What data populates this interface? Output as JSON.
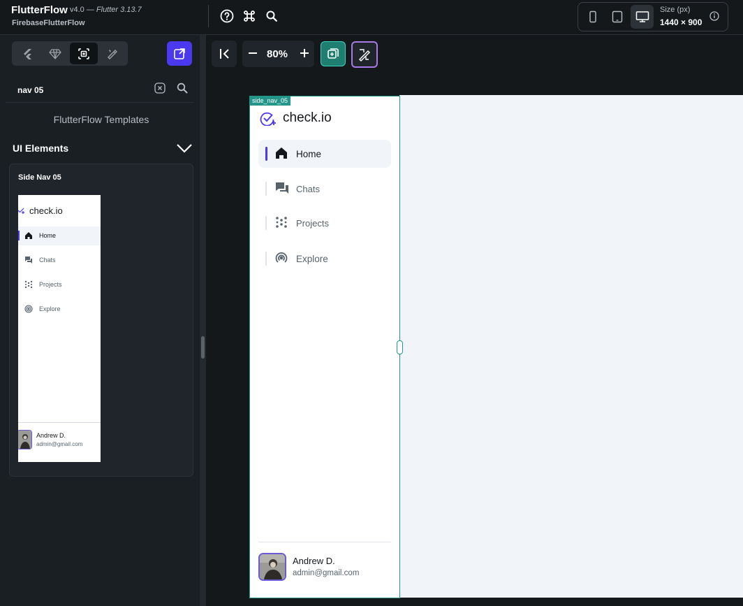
{
  "app": {
    "name": "FlutterFlow",
    "version": "v4.0 — ",
    "flutter_version": "Flutter 3.13.7",
    "project": "FirebaseFlutterFlow"
  },
  "toolbar": {
    "icons": [
      "help-icon",
      "command-icon",
      "search-icon"
    ]
  },
  "device": {
    "size_label": "Size (px)",
    "size_value": "1440 × 900",
    "options": [
      "phone",
      "tablet",
      "desktop"
    ],
    "selected": "desktop"
  },
  "left_panel": {
    "tabs": [
      "flutter-widgets",
      "components",
      "templates",
      "themes"
    ],
    "active_tab": "templates",
    "search_value": "nav 05",
    "templates_label": "FlutterFlow Templates",
    "section_title": "UI Elements",
    "card": {
      "title": "Side Nav 05"
    }
  },
  "canvas": {
    "zoom": "80%",
    "frame_tag": "side_nav_05"
  },
  "side_nav": {
    "logo": "check.io",
    "items": [
      {
        "label": "Home",
        "icon": "home-icon",
        "active": true
      },
      {
        "label": "Chats",
        "icon": "chat-icon",
        "active": false
      },
      {
        "label": "Projects",
        "icon": "dots-grid-icon",
        "active": false
      },
      {
        "label": "Explore",
        "icon": "explore-icon",
        "active": false
      }
    ],
    "user": {
      "name": "Andrew D.",
      "email": "admin@gmail.com"
    }
  },
  "colors": {
    "primary": "#4b39ef",
    "accent_teal": "#249689",
    "dark_bg": "#14181b",
    "canvas_bg": "#f1f4f8"
  }
}
